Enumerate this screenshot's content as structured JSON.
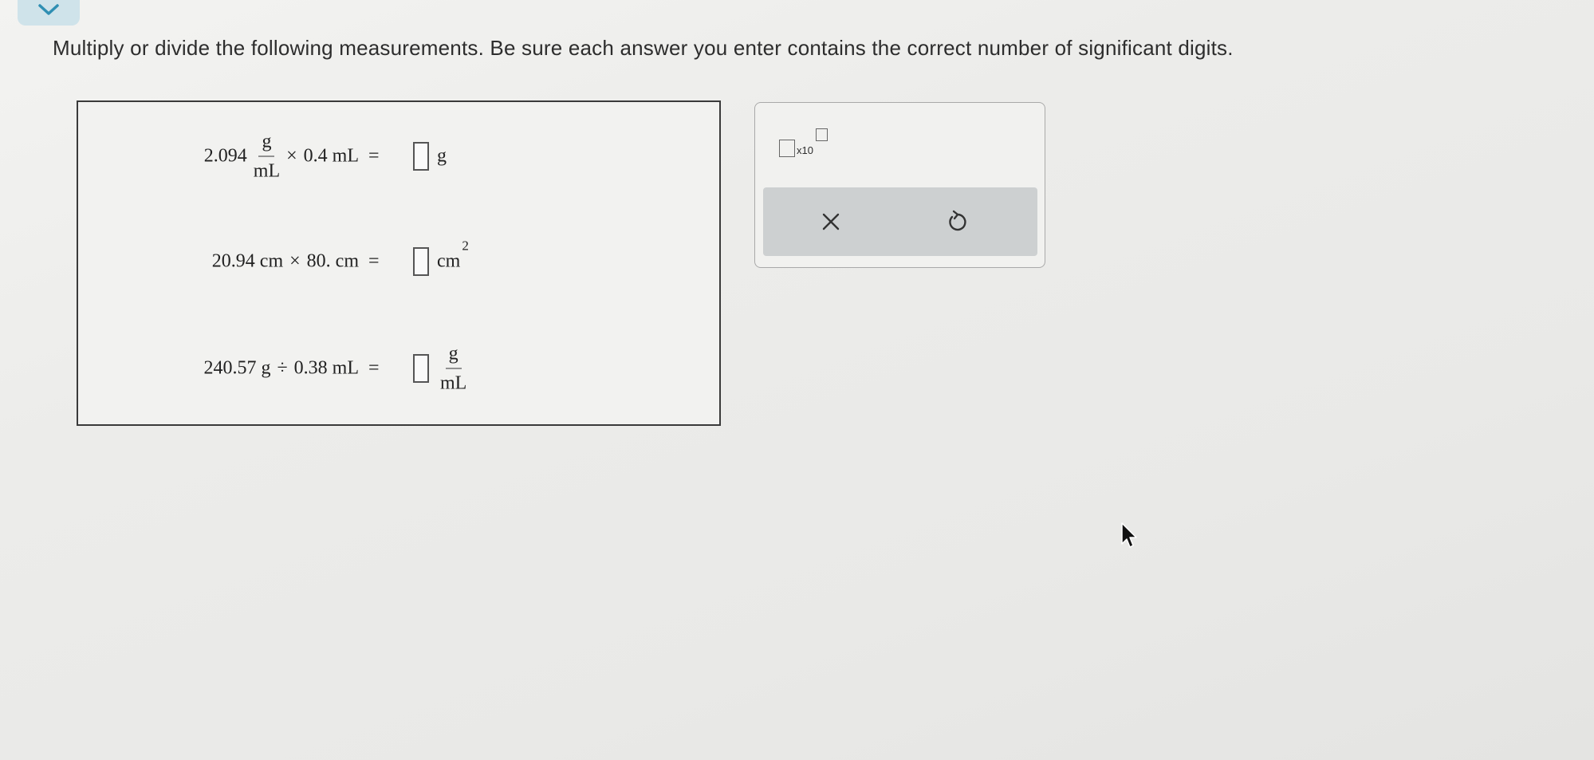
{
  "instructions": "Multiply or divide the following measurements. Be sure each answer you enter contains the correct number of significant digits.",
  "problems": [
    {
      "value_a": "2.094",
      "value_a_unit_num": "g",
      "value_a_unit_den": "mL",
      "operator": "×",
      "value_b": "0.4 mL",
      "equals": "=",
      "answer_value": "",
      "answer_unit": "g"
    },
    {
      "value_a": "20.94 cm",
      "operator": "×",
      "value_b": "80. cm",
      "equals": "=",
      "answer_value": "",
      "answer_unit": "cm",
      "answer_unit_exponent": "2"
    },
    {
      "value_a": "240.57 g",
      "operator": "÷",
      "value_b": "0.38 mL",
      "equals": "=",
      "answer_value": "",
      "answer_unit_num": "g",
      "answer_unit_den": "mL"
    }
  ],
  "tools": {
    "sci_notation_label": "x10",
    "clear_icon": "x-icon",
    "undo_icon": "undo-icon"
  },
  "colors": {
    "tab_background": "#cfe3ea",
    "action_bar": "#cdd0d1",
    "tab_chevron": "#2f8fb3"
  }
}
